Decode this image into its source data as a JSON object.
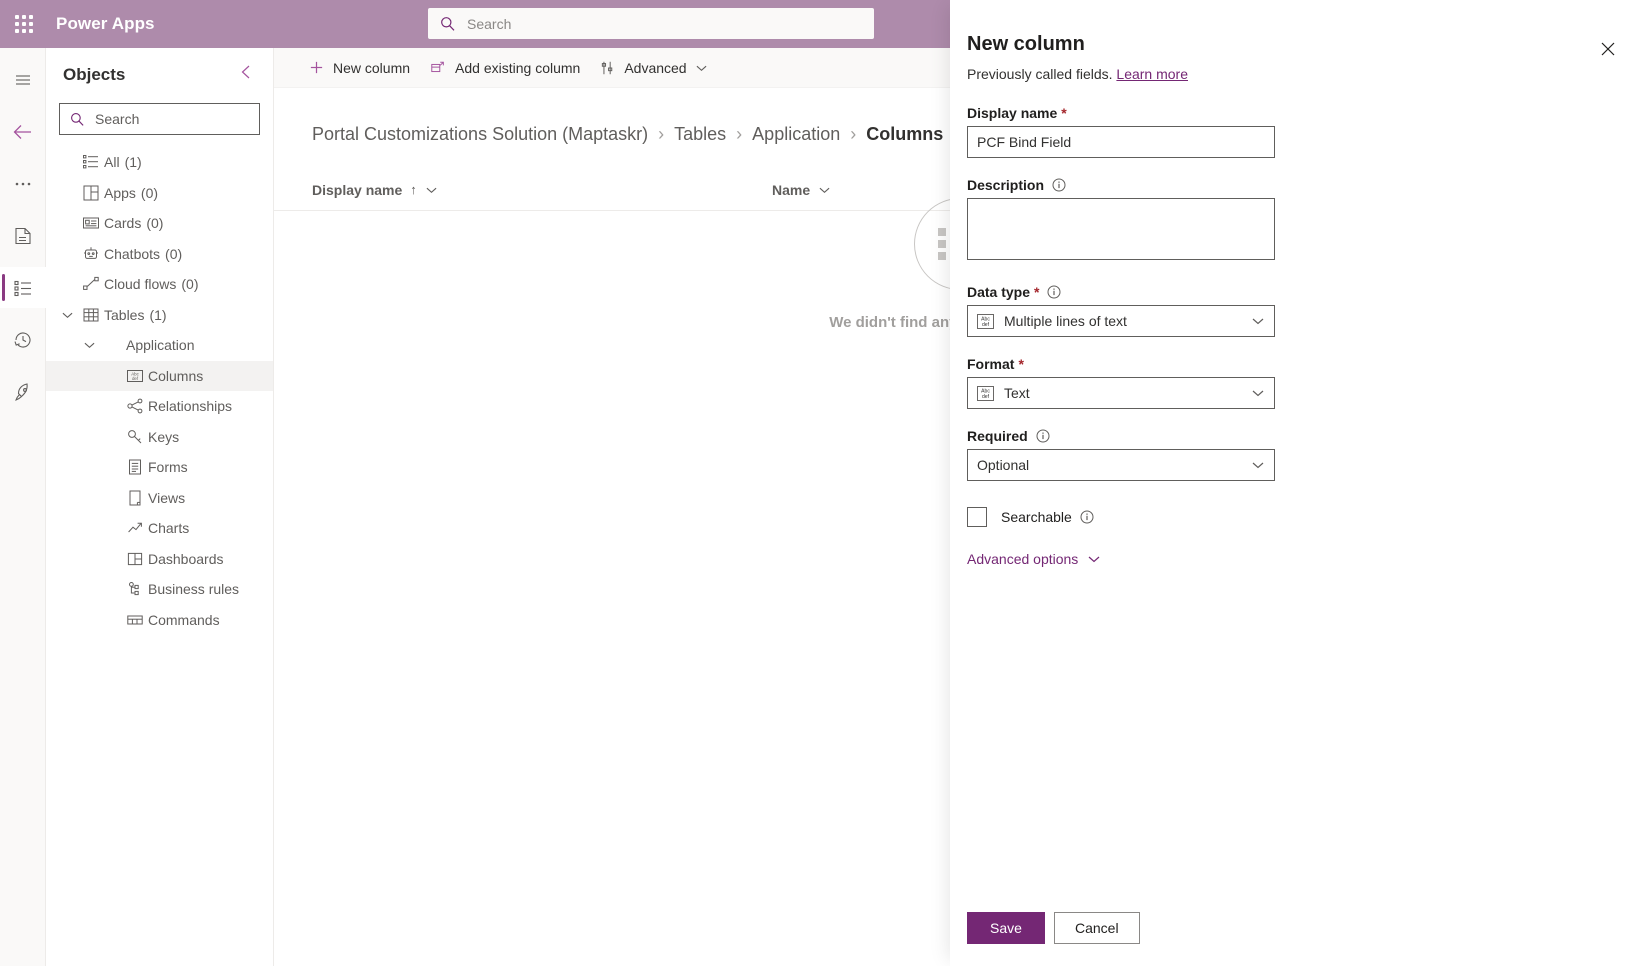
{
  "topbar": {
    "waffle_label": "app-launcher",
    "brand": "Power Apps",
    "search_placeholder": "Search"
  },
  "rail": {
    "items": [
      {
        "name": "hamburger-menu",
        "icon": "hamburger-icon",
        "selected": false
      },
      {
        "name": "back",
        "icon": "back-arrow-icon",
        "selected": false
      },
      {
        "name": "more",
        "icon": "ellipsis-icon",
        "selected": false
      },
      {
        "name": "solution",
        "icon": "solution-icon",
        "selected": false
      },
      {
        "name": "objects",
        "icon": "objects-list-icon",
        "selected": true
      },
      {
        "name": "history",
        "icon": "history-clock-icon",
        "selected": false
      },
      {
        "name": "publish",
        "icon": "rocket-icon",
        "selected": false
      }
    ]
  },
  "objects": {
    "title": "Objects",
    "collapse_icon": "chevron-left-icon",
    "search_placeholder": "Search",
    "tree": [
      {
        "label": "All",
        "count": "(1)",
        "icon": "all-list-icon",
        "level": 0,
        "chevron": "",
        "selected": false
      },
      {
        "label": "Apps",
        "count": "(0)",
        "icon": "apps-grid-icon",
        "level": 0,
        "chevron": "",
        "selected": false
      },
      {
        "label": "Cards",
        "count": "(0)",
        "icon": "card-icon",
        "level": 0,
        "chevron": "",
        "selected": false
      },
      {
        "label": "Chatbots",
        "count": "(0)",
        "icon": "chatbot-icon",
        "level": 0,
        "chevron": "",
        "selected": false
      },
      {
        "label": "Cloud flows",
        "count": "(0)",
        "icon": "cloud-flow-icon",
        "level": 0,
        "chevron": "",
        "selected": false
      },
      {
        "label": "Tables",
        "count": "(1)",
        "icon": "table-grid-icon",
        "level": 0,
        "chevron": "chevron-down-icon",
        "selected": false
      },
      {
        "label": "Application",
        "count": "",
        "icon": "",
        "level": 1,
        "chevron": "chevron-down-icon",
        "selected": false
      },
      {
        "label": "Columns",
        "count": "",
        "icon": "columns-abc-icon",
        "level": 2,
        "chevron": "",
        "selected": true
      },
      {
        "label": "Relationships",
        "count": "",
        "icon": "relationships-icon",
        "level": 2,
        "chevron": "",
        "selected": false
      },
      {
        "label": "Keys",
        "count": "",
        "icon": "key-icon",
        "level": 2,
        "chevron": "",
        "selected": false
      },
      {
        "label": "Forms",
        "count": "",
        "icon": "form-icon",
        "level": 2,
        "chevron": "",
        "selected": false
      },
      {
        "label": "Views",
        "count": "",
        "icon": "view-page-icon",
        "level": 2,
        "chevron": "",
        "selected": false
      },
      {
        "label": "Charts",
        "count": "",
        "icon": "chart-line-icon",
        "level": 2,
        "chevron": "",
        "selected": false
      },
      {
        "label": "Dashboards",
        "count": "",
        "icon": "dashboard-icon",
        "level": 2,
        "chevron": "",
        "selected": false
      },
      {
        "label": "Business rules",
        "count": "",
        "icon": "business-rules-icon",
        "level": 2,
        "chevron": "",
        "selected": false
      },
      {
        "label": "Commands",
        "count": "",
        "icon": "commands-icon",
        "level": 2,
        "chevron": "",
        "selected": false
      }
    ]
  },
  "commandbar": {
    "new_column": "New column",
    "add_existing_column": "Add existing column",
    "advanced": "Advanced"
  },
  "breadcrumb": {
    "items": [
      {
        "label": "Portal Customizations Solution (Maptaskr)",
        "current": false
      },
      {
        "label": "Tables",
        "current": false
      },
      {
        "label": "Application",
        "current": false
      },
      {
        "label": "Columns",
        "current": true
      }
    ],
    "separator": "›"
  },
  "grid": {
    "columns": [
      {
        "label": "Display name",
        "sorted": true,
        "sort_arrow": "↑"
      },
      {
        "label": "Name",
        "sorted": false,
        "sort_arrow": ""
      }
    ],
    "empty_message": "We didn't find anything to show here",
    "empty_icon": "empty-list-icon"
  },
  "panel": {
    "title": "New column",
    "subtitle_text": "Previously called fields.",
    "subtitle_link": "Learn more",
    "close_icon": "close-icon",
    "fields": {
      "display_name": {
        "label": "Display name",
        "required": true,
        "value": "PCF Bind Field",
        "placeholder": ""
      },
      "description": {
        "label": "Description",
        "required": false,
        "has_info": true,
        "value": "",
        "placeholder": ""
      },
      "data_type": {
        "label": "Data type",
        "required": true,
        "has_info": true,
        "value": "Multiple lines of text",
        "icon": "abc-def-text-icon"
      },
      "format": {
        "label": "Format",
        "required": true,
        "has_info": false,
        "value": "Text",
        "icon": "abc-def-text-icon"
      },
      "required_level": {
        "label": "Required",
        "required": false,
        "has_info": true,
        "value": "Optional",
        "icon": ""
      },
      "searchable": {
        "label": "Searchable",
        "has_info": true,
        "checked": false
      }
    },
    "advanced_options": "Advanced options",
    "save_label": "Save",
    "cancel_label": "Cancel"
  },
  "colors": {
    "brand_bar": "#ae8bab",
    "accent": "#742774",
    "selected_rail": "#8a3a82",
    "required_star": "#a4262c",
    "text_primary": "#201f1e",
    "text_secondary": "#605e5c"
  }
}
